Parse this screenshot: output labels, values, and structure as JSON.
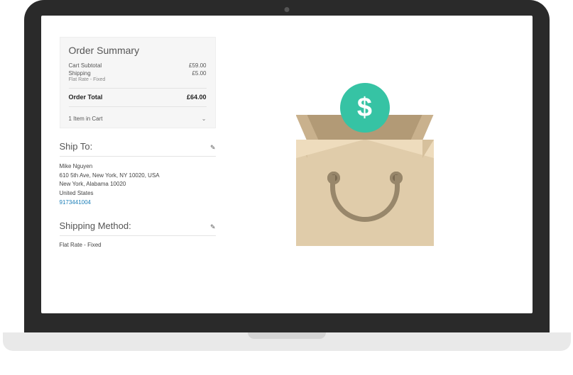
{
  "orderSummary": {
    "title": "Order Summary",
    "subtotalLabel": "Cart Subtotal",
    "subtotalValue": "£59.00",
    "shippingLabel": "Shipping",
    "shippingSub": "Flat Rate - Fixed",
    "shippingValue": "£5.00",
    "totalLabel": "Order Total",
    "totalValue": "£64.00",
    "cartCountText": "1 Item in Cart"
  },
  "shipTo": {
    "title": "Ship To:",
    "name": "Mike Nguyen",
    "line1": "610 5th Ave, New York, NY 10020, USA",
    "line2": "New York, Alabama 10020",
    "country": "United States",
    "phone": "9173441004"
  },
  "shippingMethod": {
    "title": "Shipping Method:",
    "value": "Flat Rate - Fixed"
  },
  "illustration": {
    "coinSymbol": "$"
  }
}
